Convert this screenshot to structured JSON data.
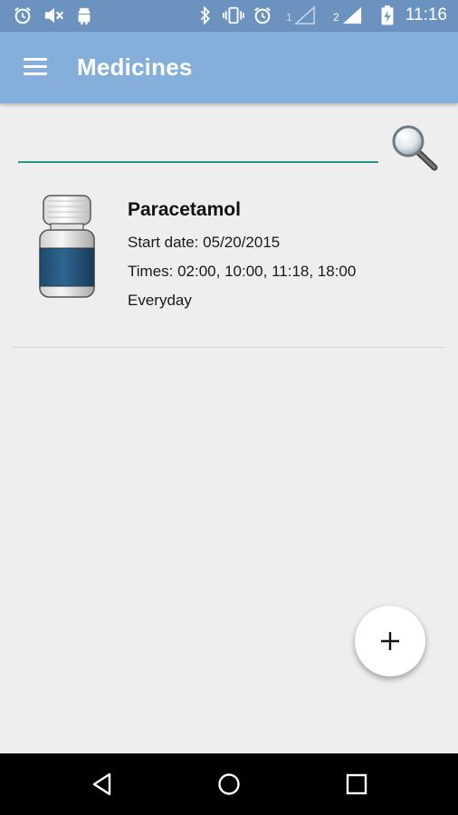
{
  "status_bar": {
    "time": "11:16",
    "sim1_label": "1",
    "sim2_label": "2",
    "icons": [
      "alarm-icon",
      "mute-icon",
      "android-icon",
      "bluetooth-icon",
      "vibrate-icon",
      "alarm-icon",
      "signal-icon",
      "signal-icon",
      "battery-charging-icon"
    ]
  },
  "app_bar": {
    "title": "Medicines",
    "menu_icon": "menu-icon",
    "color": "#84afdb"
  },
  "search": {
    "value": "",
    "placeholder": "",
    "icon": "magnifier-icon",
    "underline_color": "#2b9486"
  },
  "medicines": [
    {
      "name": "Paracetamol",
      "start_date": "Start date: 05/20/2015",
      "times": "Times: 02:00, 10:00, 11:18, 18:00",
      "frequency": "Everyday",
      "icon": "pill-bottle-icon"
    }
  ],
  "fab": {
    "icon": "plus-icon"
  },
  "nav_bar": {
    "icons": [
      "back-icon",
      "home-icon",
      "recents-icon"
    ]
  }
}
